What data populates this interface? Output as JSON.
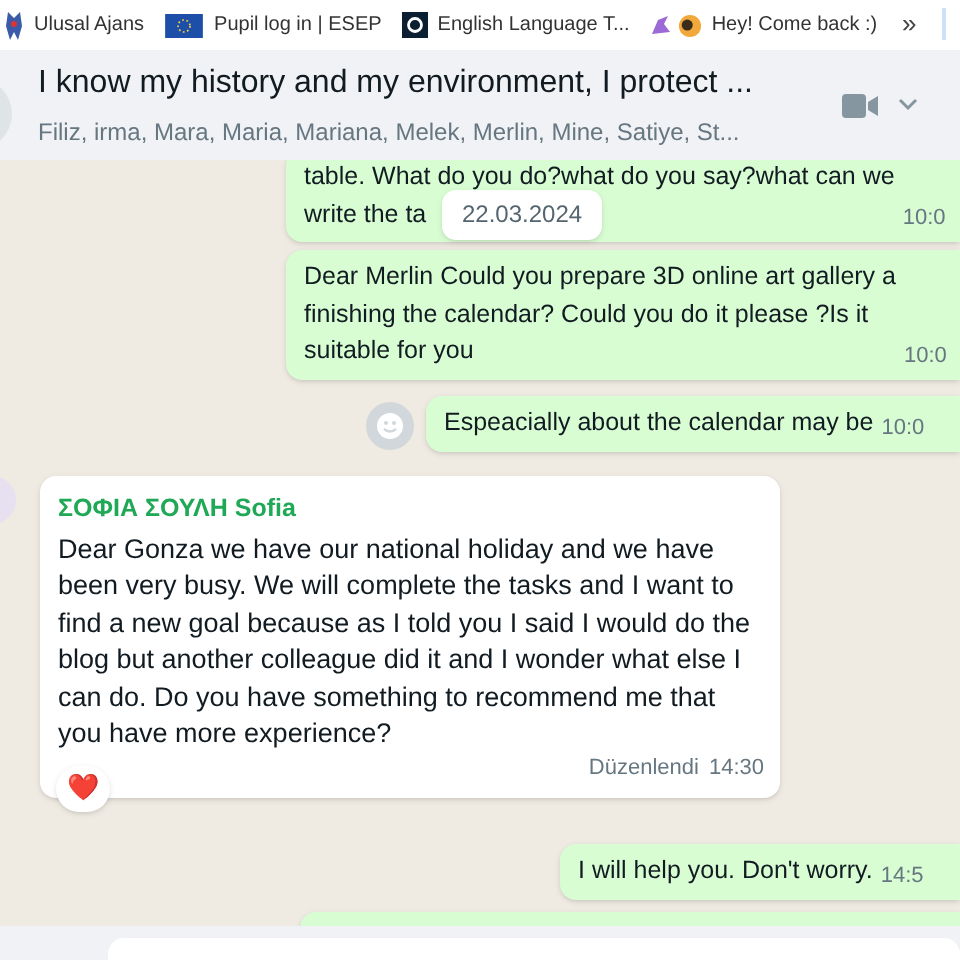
{
  "bookmarks": [
    {
      "label": "Ulusal Ajans"
    },
    {
      "label": "Pupil log in | ESEP"
    },
    {
      "label": "English Language T..."
    },
    {
      "label": "Hey! Come back :)"
    }
  ],
  "bookmarks_more": "»",
  "chat": {
    "title": "I know my history and my environment, I protect ...",
    "members": "Filiz, irma, Mara, Maria, Mariana, Melek, Merlin, Mine, Satiye, St..."
  },
  "date_pill": "22.03.2024",
  "messages": [
    {
      "kind": "outgoing",
      "lines": [
        "table. What do you do?what do you say?what can we",
        "write the ta"
      ],
      "time": "10:0"
    },
    {
      "kind": "outgoing",
      "lines": [
        "Dear Merlin Could you prepare 3D online art gallery a",
        "finishing the calendar? Could you do it please ?Is it",
        "suitable for you"
      ],
      "time": "10:0"
    },
    {
      "kind": "outgoing",
      "lines": [
        "Espeacially about the calendar may be"
      ],
      "time": "10:0",
      "emoji_button": true
    },
    {
      "kind": "incoming",
      "sender": "ΣΟΦΙΑ ΣΟΥΛΗ Sofia",
      "lines": [
        "Dear Gonza we have our national holiday and we have",
        "been very busy. We will complete the tasks and I want to",
        "find a new goal because as I told you I said I would do the",
        "blog but another colleague did it and I wonder what else I",
        "can do. Do you have something to recommend me that",
        "you have more experience?"
      ],
      "edited": "Düzenlendi",
      "time": "14:30",
      "reaction": "❤️"
    },
    {
      "kind": "outgoing",
      "lines": [
        "I will help you. Don't worry."
      ],
      "time": "14:5"
    },
    {
      "kind": "outgoing_partial"
    }
  ]
}
